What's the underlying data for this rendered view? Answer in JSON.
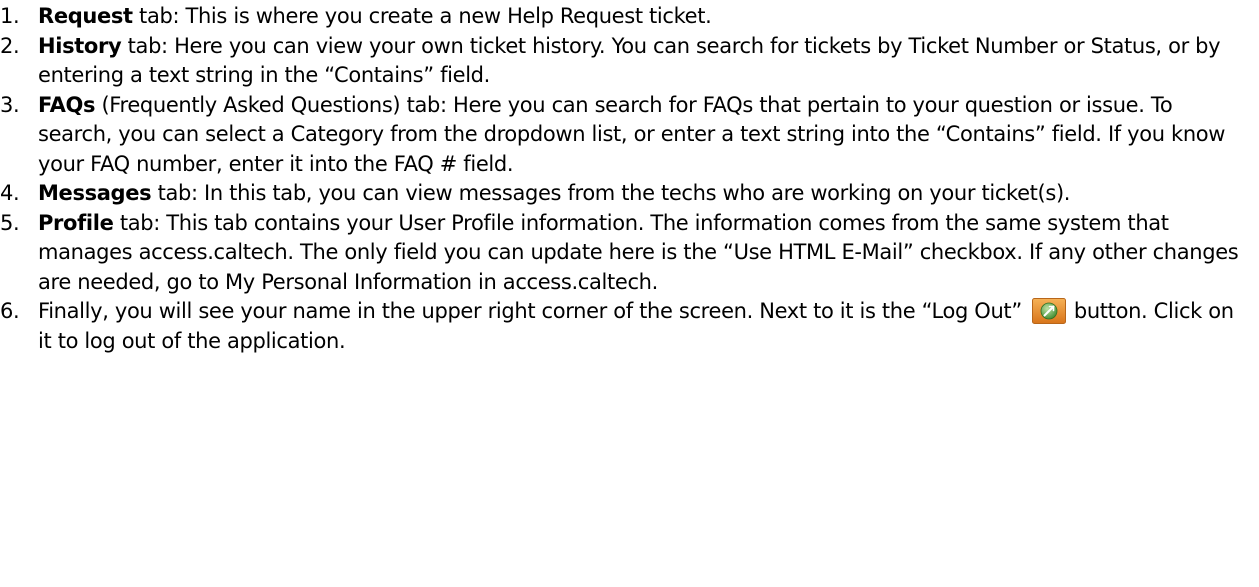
{
  "list": {
    "items": [
      {
        "number": "1.",
        "keyword": "Request",
        "rest": " tab: This is where you create a new Help Request ticket."
      },
      {
        "number": "2.",
        "keyword": "History",
        "rest": " tab: Here you can view your own ticket history. You can search for tickets by Ticket Number or Status, or by entering a text string in the “Contains” field."
      },
      {
        "number": "3.",
        "keyword": "FAQs",
        "rest": " (Frequently Asked Questions) tab: Here you can search for FAQs that pertain to your question or issue. To search, you can select a Category from the dropdown list, or enter a text string into the “Contains” field. If you know your FAQ number, enter it into the FAQ # field."
      },
      {
        "number": "4.",
        "keyword": "Messages",
        "rest": " tab: In this tab, you can view messages from the techs who are working on your ticket(s)."
      },
      {
        "number": "5.",
        "keyword": "Profile",
        "rest": " tab: This tab contains your User Profile information. The information comes from the same system that manages access.caltech. The only field you can update here is the “Use HTML E-Mail” checkbox. If any other changes are needed, go to My Personal Information in access.caltech."
      },
      {
        "number": "6.",
        "text_before_icon": "Finally, you will see your name in the upper right corner of the screen. Next to it is the “Log Out”",
        "text_after_icon": "button. Click on it to log out of the application.",
        "icon": "logout-icon"
      }
    ]
  },
  "colors": {
    "text": "#000000",
    "icon_orange": "#e8891c",
    "icon_green": "#4f9a3a"
  }
}
